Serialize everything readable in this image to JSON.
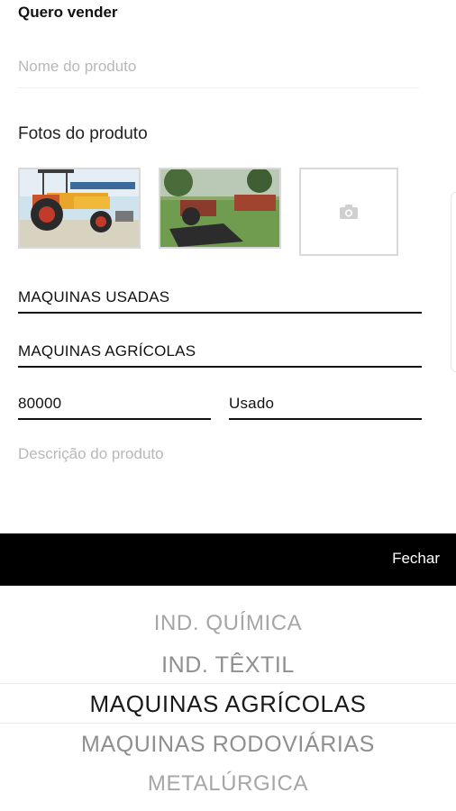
{
  "form": {
    "title": "Quero vender",
    "name_placeholder": "Nome do produto",
    "photos_label": "Fotos do produto",
    "photos": [
      {
        "icon": "tractor-photo-1"
      },
      {
        "icon": "tractor-photo-2"
      }
    ],
    "add_photo_icon": "camera-icon",
    "category": "MAQUINAS USADAS",
    "subcategory": "MAQUINAS AGRÍCOLAS",
    "price": "80000",
    "condition": "Usado",
    "description_placeholder": "Descrição do produto"
  },
  "picker": {
    "close_label": "Fechar",
    "options": [
      "IND. QUÍMICA",
      "IND. TÊXTIL",
      "MAQUINAS AGRÍCOLAS",
      "MAQUINAS RODOVIÁRIAS",
      "METALÚRGICA"
    ],
    "selected": "MAQUINAS AGRÍCOLAS"
  },
  "colors": {
    "toolbar_bg": "#000000",
    "field_underline": "#111111",
    "placeholder": "#b8b8b8"
  }
}
